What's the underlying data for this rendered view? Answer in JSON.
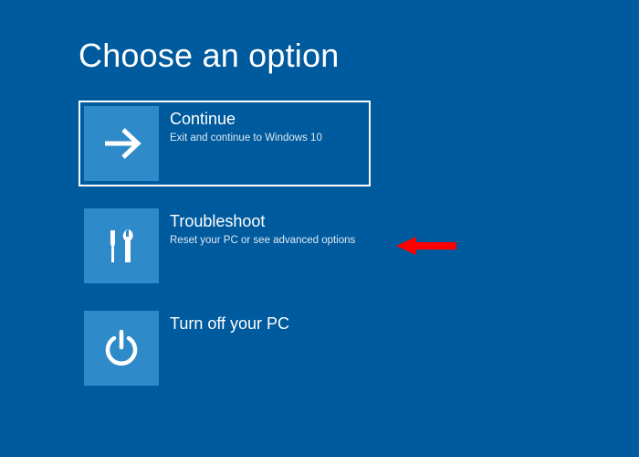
{
  "heading": "Choose an option",
  "options": [
    {
      "title": "Continue",
      "description": "Exit and continue to Windows 10",
      "icon": "arrow-right-icon",
      "selected": true
    },
    {
      "title": "Troubleshoot",
      "description": "Reset your PC or see advanced options",
      "icon": "tools-icon",
      "selected": false
    },
    {
      "title": "Turn off your PC",
      "description": "",
      "icon": "power-icon",
      "selected": false
    }
  ],
  "colors": {
    "background": "#005a9e",
    "tile": "#2f8ac9",
    "text": "#ffffff",
    "arrow_annotation": "#ff0000"
  }
}
